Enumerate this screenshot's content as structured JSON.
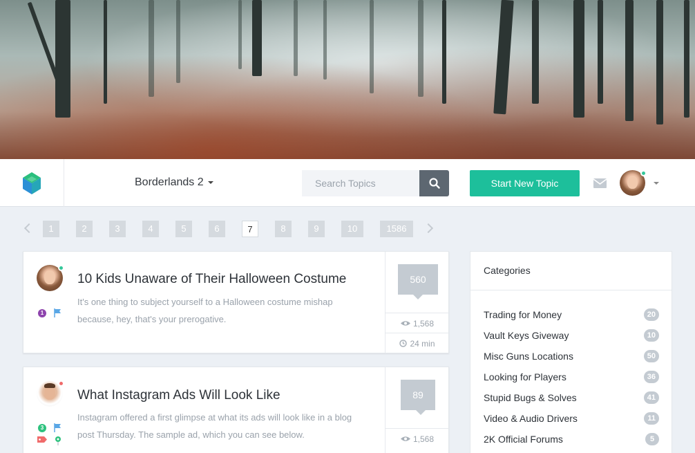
{
  "navbar": {
    "forum_name": "Borderlands 2",
    "search_placeholder": "Search Topics",
    "start_topic_label": "Start New Topic"
  },
  "pagination": {
    "pages": [
      "1",
      "2",
      "3",
      "4",
      "5",
      "6",
      "7",
      "8",
      "9",
      "10",
      "1586"
    ],
    "current": "7"
  },
  "topics": [
    {
      "title": "10 Kids Unaware of Their Halloween Costume",
      "excerpt": "It's one thing to subject yourself to a Halloween costume mishap because, hey, that's your prerogative.",
      "replies": "560",
      "views": "1,568",
      "time": "24 min",
      "badge": "1",
      "author_status": "online"
    },
    {
      "title": "What Instagram Ads Will Look Like",
      "excerpt": "Instagram offered a first glimpse at what its ads will look like in a blog post Thursday. The sample ad, which you can see below.",
      "replies": "89",
      "views": "1,568",
      "badge": "3",
      "author_status": "busy"
    }
  ],
  "categories": {
    "title": "Categories",
    "items": [
      {
        "label": "Trading for Money",
        "count": "20"
      },
      {
        "label": "Vault Keys Giveway",
        "count": "10"
      },
      {
        "label": "Misc Guns Locations",
        "count": "50"
      },
      {
        "label": "Looking for Players",
        "count": "36"
      },
      {
        "label": "Stupid Bugs & Solves",
        "count": "41"
      },
      {
        "label": "Video & Audio Drivers",
        "count": "11"
      },
      {
        "label": "2K Official Forums",
        "count": "5"
      }
    ]
  },
  "colors": {
    "accent": "#1dbf9b",
    "search_button": "#5d6771",
    "online": "#35c79a",
    "busy": "#f06b6b",
    "background": "#ecf0f5"
  }
}
